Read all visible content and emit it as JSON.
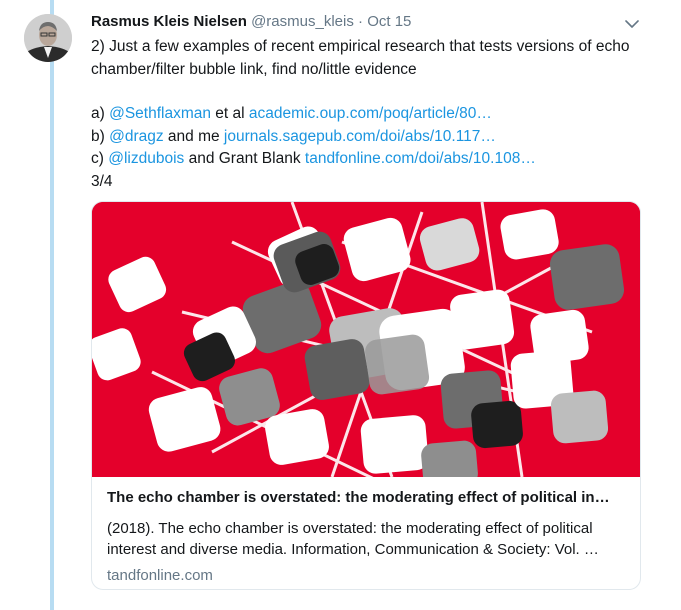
{
  "tweet": {
    "author_name": "Rasmus Kleis Nielsen",
    "handle": "@rasmus_kleis",
    "separator": "·",
    "date": "Oct 15",
    "text_line1": "2) Just a few examples of recent empirical research that tests versions of echo",
    "text_line2": "chamber/filter bubble link, find no/little evidence",
    "refs": [
      {
        "prefix": "a) ",
        "mention": "@Sethflaxman",
        "middle": " et al ",
        "link": "academic.oup.com/poq/article/80…"
      },
      {
        "prefix": "b) ",
        "mention": "@dragz",
        "middle": " and me ",
        "link": "journals.sagepub.com/doi/abs/10.117…"
      },
      {
        "prefix": "c) ",
        "mention": "@lizdubois",
        "middle": " and Grant Blank ",
        "link": "tandfonline.com/doi/abs/10.108…"
      }
    ],
    "counter": "3/4"
  },
  "card": {
    "title": "The echo chamber is overstated: the moderating effect of political in…",
    "description": "(2018). The echo chamber is overstated: the moderating effect of political interest and diverse media. Information, Communication & Society: Vol. …",
    "domain": "tandfonline.com"
  },
  "colors": {
    "link": "#1b95e0",
    "muted": "#657786",
    "thread_line": "#b7dcf2",
    "card_image_bg": "#e4002b"
  },
  "icons": {
    "menu": "chevron-down-icon"
  }
}
